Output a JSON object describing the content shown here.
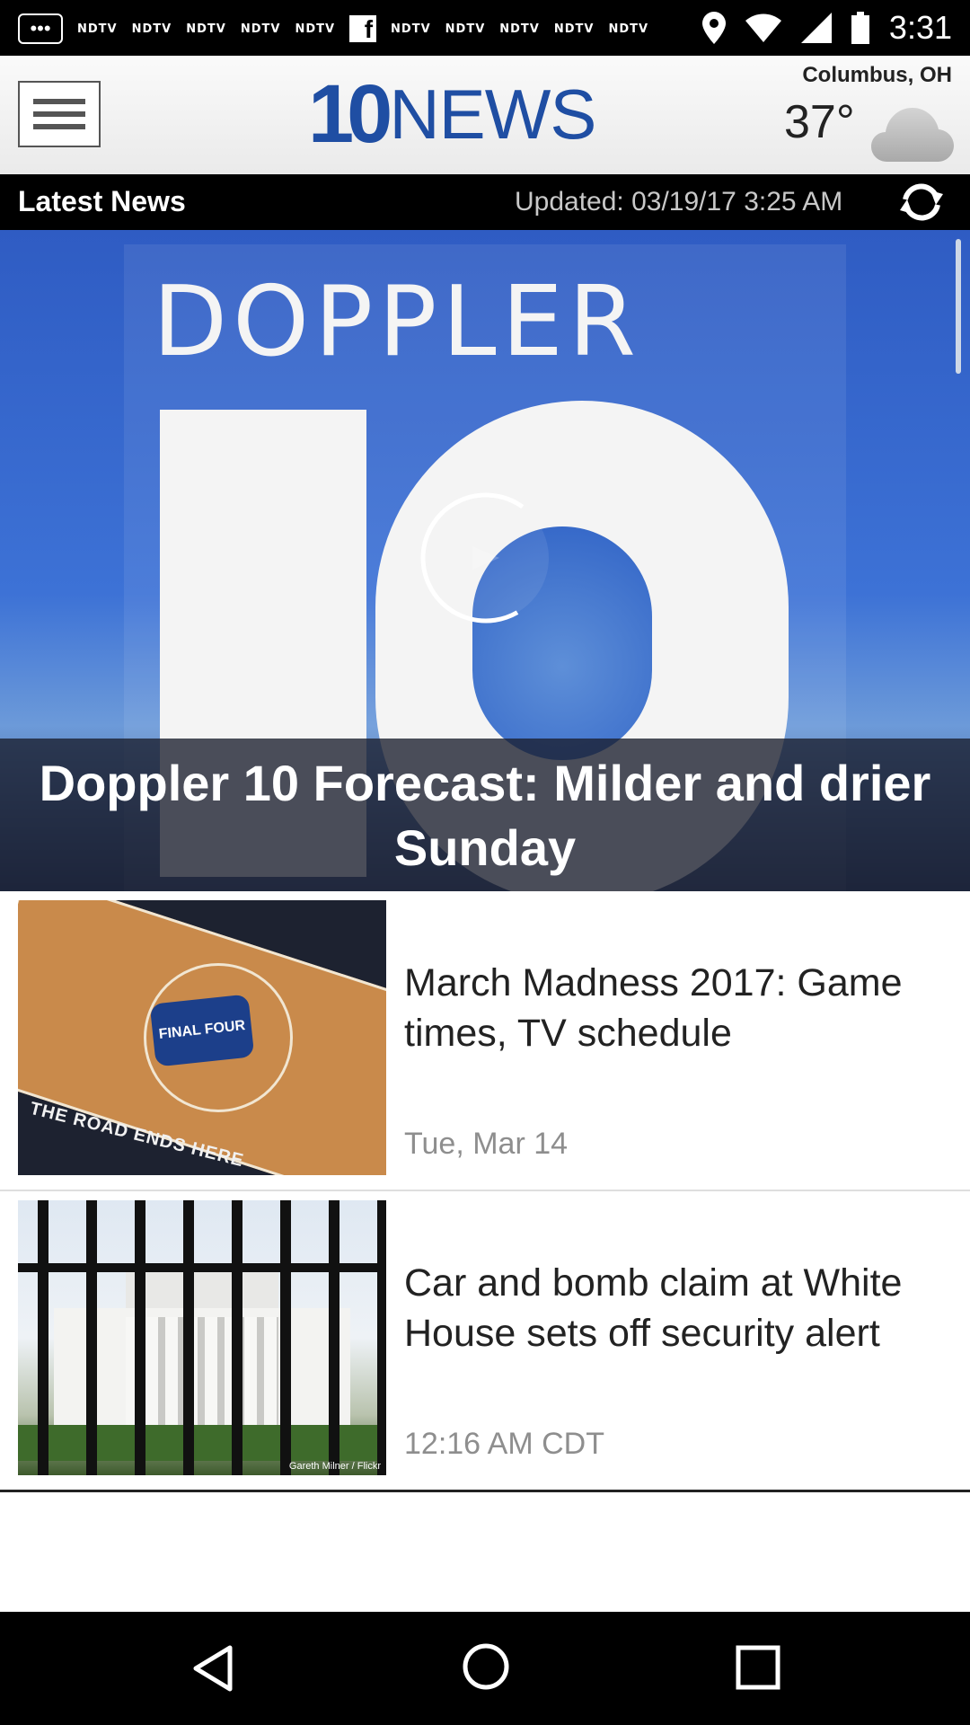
{
  "status_bar": {
    "time": "3:31",
    "notification_labels": [
      "NDTV",
      "NDTV",
      "NDTV",
      "NDTV",
      "NDTV",
      "NDTV",
      "NDTV",
      "NDTV",
      "NDTV",
      "NDTV"
    ],
    "icons": [
      "more-icon",
      "facebook-icon",
      "location-icon",
      "wifi-icon",
      "signal-icon",
      "battery-icon"
    ]
  },
  "header": {
    "logo_number": "10",
    "logo_word": "NEWS",
    "location": "Columbus, OH",
    "temperature": "37°",
    "weather_icon": "cloud-icon",
    "brand_color": "#1f4ea3"
  },
  "news_bar": {
    "title": "Latest News",
    "updated": "Updated: 03/19/17 3:25 AM"
  },
  "hero": {
    "image_text": "DOPPLER",
    "caption": "Doppler 10 Forecast: Milder and drier Sunday"
  },
  "articles": [
    {
      "title": "March Madness 2017: Game times, TV schedule",
      "date": "Tue, Mar 14",
      "thumb_text": "FINAL FOUR",
      "thumb_caption": "THE ROAD ENDS HERE"
    },
    {
      "title": "Car and bomb claim at White House sets off security alert",
      "date": "12:16 AM CDT",
      "thumb_credit": "Gareth Milner / Flickr"
    }
  ]
}
